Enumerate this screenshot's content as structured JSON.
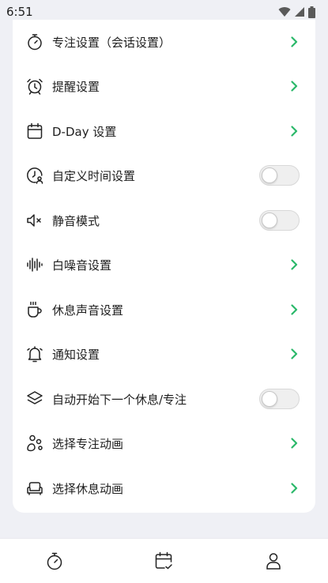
{
  "status_bar": {
    "time": "6:51"
  },
  "settings": [
    {
      "label": "专注设置（会话设置）",
      "icon": "stopwatch-icon",
      "control": "chevron"
    },
    {
      "label": "提醒设置",
      "icon": "alarm-clock-icon",
      "control": "chevron"
    },
    {
      "label": "D-Day 设置",
      "icon": "calendar-icon",
      "control": "chevron"
    },
    {
      "label": "自定义时间设置",
      "icon": "clock-user-icon",
      "control": "toggle",
      "on": false
    },
    {
      "label": "静音模式",
      "icon": "speaker-mute-icon",
      "control": "toggle",
      "on": false
    },
    {
      "label": "白噪音设置",
      "icon": "waveform-icon",
      "control": "chevron"
    },
    {
      "label": "休息声音设置",
      "icon": "coffee-cup-icon",
      "control": "chevron"
    },
    {
      "label": "通知设置",
      "icon": "bell-icon",
      "control": "chevron"
    },
    {
      "label": "自动开始下一个休息/专注",
      "icon": "layers-icon",
      "control": "toggle",
      "on": false
    },
    {
      "label": "选择专注动画",
      "icon": "shapes-icon",
      "control": "chevron"
    },
    {
      "label": "选择休息动画",
      "icon": "sofa-icon",
      "control": "chevron"
    }
  ],
  "bottom_nav": [
    {
      "icon": "timer-icon"
    },
    {
      "icon": "calendar-check-icon"
    },
    {
      "icon": "profile-icon"
    }
  ],
  "colors": {
    "accent": "#2bb86a",
    "background": "#eff0f5",
    "card": "#ffffff"
  }
}
